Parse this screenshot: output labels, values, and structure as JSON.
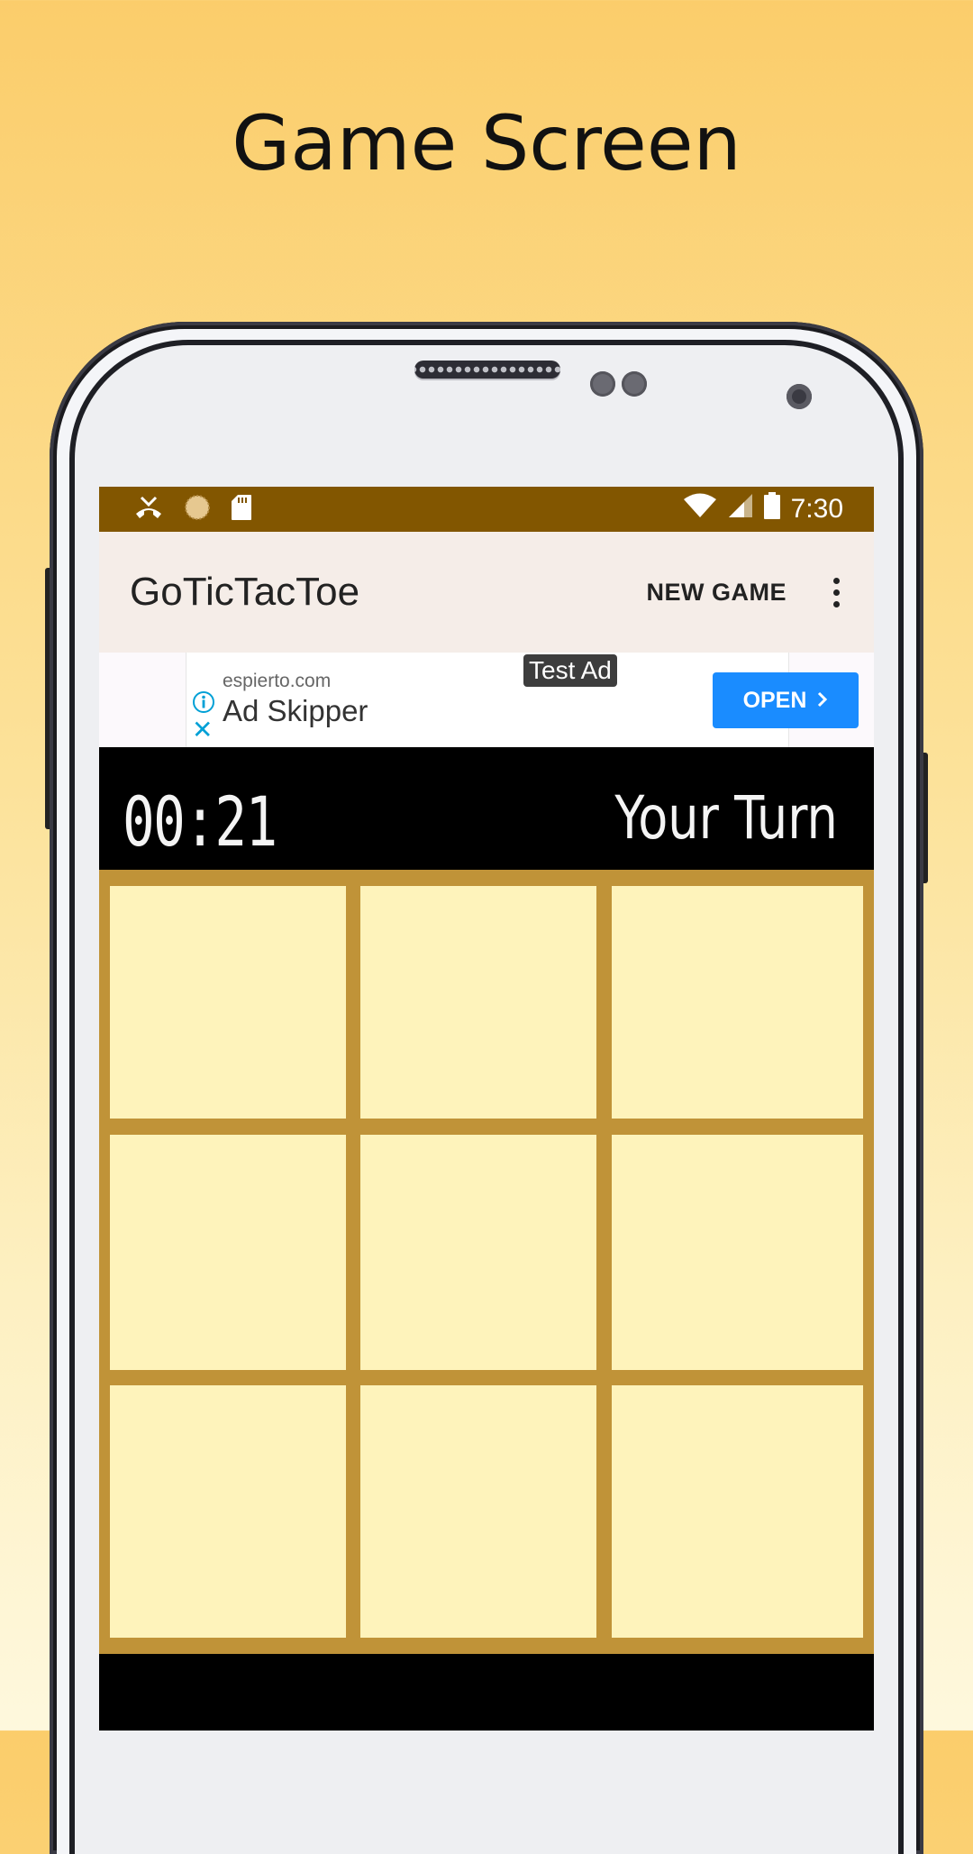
{
  "promo": {
    "title": "Game Screen"
  },
  "status_bar": {
    "time": "7:30",
    "icons": [
      "missed-call-icon",
      "sync-icon",
      "sd-card-icon",
      "wifi-icon",
      "signal-icon",
      "battery-icon"
    ]
  },
  "app_bar": {
    "title": "GoTicTacToe",
    "new_game_label": "NEW GAME",
    "menu_icon": "overflow-menu-icon"
  },
  "ad": {
    "badge": "Test Ad",
    "domain": "espierto.com",
    "name": "Ad Skipper",
    "open_label": "OPEN"
  },
  "game": {
    "timer": "00:21",
    "turn_text": "Your Turn",
    "board": [
      "",
      "",
      "",
      "",
      "",
      "",
      "",
      "",
      ""
    ]
  },
  "colors": {
    "status_bar": "#825600",
    "app_bar": "#f5ede8",
    "board_frame": "#c09338",
    "cell": "#fef3bb",
    "ad_button": "#1a8cff"
  }
}
